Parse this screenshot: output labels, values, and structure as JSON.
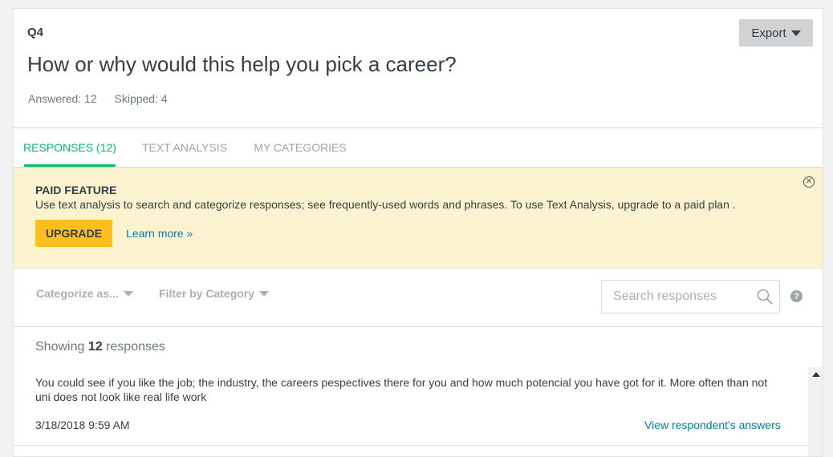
{
  "question": {
    "number": "Q4",
    "title": "How or why would this help you pick a career?",
    "answered_label": "Answered: 12",
    "skipped_label": "Skipped: 4"
  },
  "toolbar": {
    "export_label": "Export"
  },
  "tabs": [
    {
      "label": "RESPONSES (12)",
      "active": true
    },
    {
      "label": "TEXT ANALYSIS",
      "active": false
    },
    {
      "label": "MY CATEGORIES",
      "active": false
    }
  ],
  "banner": {
    "title": "PAID FEATURE",
    "text": "Use text analysis to search and categorize responses; see frequently-used words and phrases. To use Text Analysis, upgrade to a paid plan .",
    "upgrade_label": "UPGRADE",
    "learn_more_label": "Learn more »",
    "close_glyph": "✕"
  },
  "filters": {
    "categorize_label": "Categorize as...",
    "filter_label": "Filter by Category",
    "search_placeholder": "Search responses",
    "help_glyph": "?"
  },
  "responses": {
    "showing_prefix": "Showing",
    "showing_count": "12",
    "showing_suffix": "responses",
    "items": [
      {
        "text": "You could see if you like the job; the industry, the careers pespectives there for you and how much potencial you have got for it. More often than not uni does not look like real life work",
        "date": "3/18/2018 9:59 AM",
        "view_label": "View respondent's answers"
      }
    ]
  },
  "colors": {
    "accent_green": "#00bf6f",
    "banner_bg": "#fbf3d0",
    "upgrade_yellow": "#fcbf1e",
    "link_blue": "#007faa"
  },
  "icons": {
    "export_caret": "caret-down-icon",
    "search": "search-icon",
    "help": "help-icon",
    "close": "close-circle-icon",
    "scroll": "scroll-up-arrow-icon"
  }
}
